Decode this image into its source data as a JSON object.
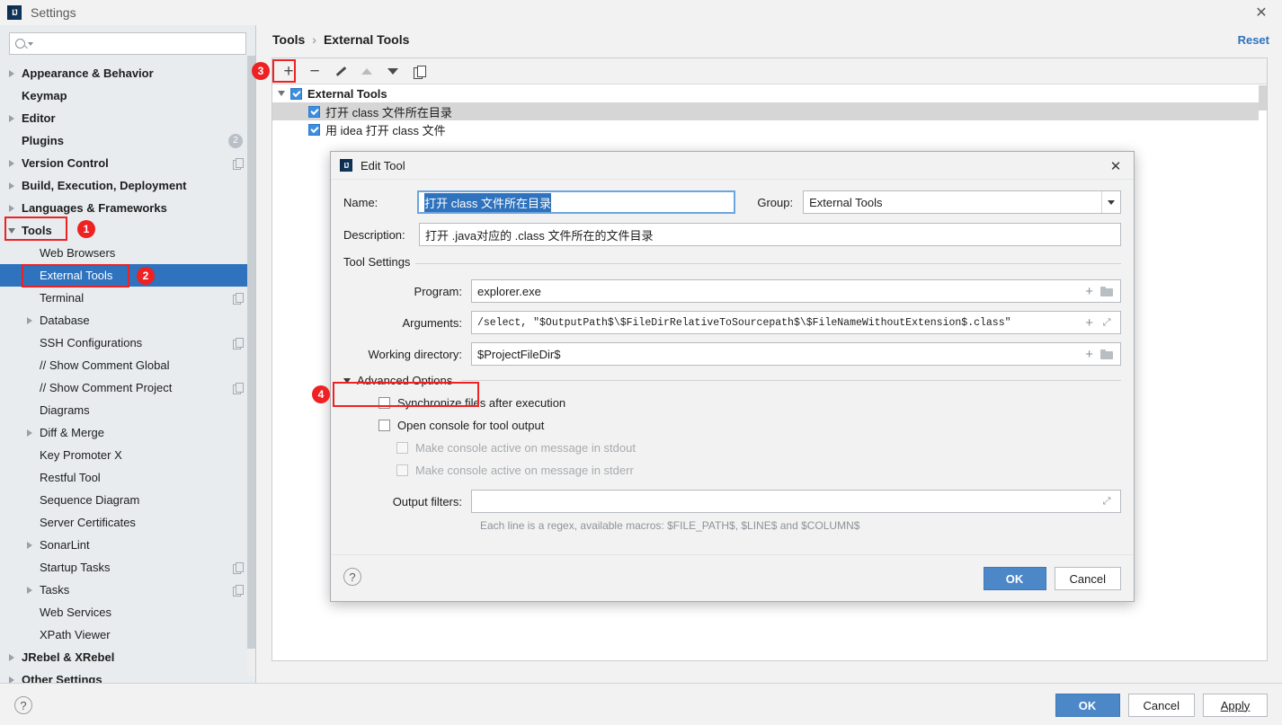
{
  "window": {
    "title": "Settings",
    "logo_text": "IJ",
    "close_icon": "✕"
  },
  "search": {
    "value": "",
    "placeholder": ""
  },
  "sidebar": {
    "items": [
      {
        "label": "Appearance & Behavior",
        "level": 0,
        "twisty": "right",
        "bold": true
      },
      {
        "label": "Keymap",
        "level": 0,
        "twisty": "none",
        "bold": true
      },
      {
        "label": "Editor",
        "level": 0,
        "twisty": "right",
        "bold": true
      },
      {
        "label": "Plugins",
        "level": 0,
        "twisty": "none",
        "bold": true,
        "badge": "2"
      },
      {
        "label": "Version Control",
        "level": 0,
        "twisty": "right",
        "bold": true,
        "copy": true
      },
      {
        "label": "Build, Execution, Deployment",
        "level": 0,
        "twisty": "right",
        "bold": true
      },
      {
        "label": "Languages & Frameworks",
        "level": 0,
        "twisty": "right",
        "bold": true
      },
      {
        "label": "Tools",
        "level": 0,
        "twisty": "down",
        "bold": true
      },
      {
        "label": "Web Browsers",
        "level": 1,
        "twisty": "none"
      },
      {
        "label": "External Tools",
        "level": 1,
        "twisty": "none",
        "selected": true
      },
      {
        "label": "Terminal",
        "level": 1,
        "twisty": "none",
        "copy": true
      },
      {
        "label": "Database",
        "level": 1,
        "twisty": "right"
      },
      {
        "label": "SSH Configurations",
        "level": 1,
        "twisty": "none",
        "copy": true
      },
      {
        "label": "// Show Comment Global",
        "level": 1,
        "twisty": "none"
      },
      {
        "label": "// Show Comment Project",
        "level": 1,
        "twisty": "none",
        "copy": true
      },
      {
        "label": "Diagrams",
        "level": 1,
        "twisty": "none"
      },
      {
        "label": "Diff & Merge",
        "level": 1,
        "twisty": "right"
      },
      {
        "label": "Key Promoter X",
        "level": 1,
        "twisty": "none"
      },
      {
        "label": "Restful Tool",
        "level": 1,
        "twisty": "none"
      },
      {
        "label": "Sequence Diagram",
        "level": 1,
        "twisty": "none"
      },
      {
        "label": "Server Certificates",
        "level": 1,
        "twisty": "none"
      },
      {
        "label": "SonarLint",
        "level": 1,
        "twisty": "right"
      },
      {
        "label": "Startup Tasks",
        "level": 1,
        "twisty": "none",
        "copy": true
      },
      {
        "label": "Tasks",
        "level": 1,
        "twisty": "right",
        "copy": true
      },
      {
        "label": "Web Services",
        "level": 1,
        "twisty": "none"
      },
      {
        "label": "XPath Viewer",
        "level": 1,
        "twisty": "none"
      },
      {
        "label": "JRebel & XRebel",
        "level": 0,
        "twisty": "right",
        "bold": true
      },
      {
        "label": "Other Settings",
        "level": 0,
        "twisty": "right",
        "bold": true
      }
    ]
  },
  "content": {
    "breadcrumb_root": "Tools",
    "breadcrumb_sep": "›",
    "breadcrumb_leaf": "External Tools",
    "reset_label": "Reset",
    "toolbar": {
      "add": "+",
      "remove": "−",
      "edit_icon": "pencil-icon",
      "move_up_icon": "arrow-up-icon",
      "move_down_icon": "arrow-down-icon",
      "copy_icon": "copy-icon"
    },
    "tree": [
      {
        "label": "External Tools",
        "level": 0,
        "checked": true,
        "bold": true,
        "twisty": "down"
      },
      {
        "label": "打开 class 文件所在目录",
        "level": 1,
        "checked": true,
        "highlighted": true
      },
      {
        "label": "用 idea 打开 class 文件",
        "level": 1,
        "checked": true
      }
    ]
  },
  "bottom_bar": {
    "help_icon": "?",
    "ok_label": "OK",
    "cancel_label": "Cancel",
    "apply_label": "Apply"
  },
  "edit_tool_dialog": {
    "title": "Edit Tool",
    "logo_text": "IJ",
    "close_icon": "✕",
    "name_label": "Name:",
    "name_value": "打开 class 文件所在目录",
    "group_label": "Group:",
    "group_value": "External Tools",
    "description_label": "Description:",
    "description_value": "打开 .java对应的 .class 文件所在的文件目录",
    "tool_settings_legend": "Tool Settings",
    "program_label": "Program:",
    "program_value": "explorer.exe",
    "arguments_label": "Arguments:",
    "arguments_value": "/select, \"$OutputPath$\\$FileDirRelativeToSourcepath$\\$FileNameWithoutExtension$.class\"",
    "working_directory_label": "Working directory:",
    "working_directory_value": "$ProjectFileDir$",
    "advanced_options_label": "Advanced Options",
    "checkboxes": [
      {
        "label": "Synchronize files after execution",
        "checked": false,
        "disabled": false,
        "indent": 0
      },
      {
        "label": "Open console for tool output",
        "checked": false,
        "disabled": false,
        "indent": 0
      },
      {
        "label": "Make console active on message in stdout",
        "checked": false,
        "disabled": true,
        "indent": 1
      },
      {
        "label": "Make console active on message in stderr",
        "checked": false,
        "disabled": true,
        "indent": 1
      }
    ],
    "output_filters_label": "Output filters:",
    "output_filters_value": "",
    "output_filters_hint": "Each line is a regex, available macros: $FILE_PATH$, $LINE$ and $COLUMN$",
    "help_icon": "?",
    "ok_label": "OK",
    "cancel_label": "Cancel"
  },
  "annotations": [
    {
      "number": "1",
      "target": "tools-sidebar-item"
    },
    {
      "number": "2",
      "target": "external-tools-sidebar-item"
    },
    {
      "number": "3",
      "target": "add-tool-button"
    },
    {
      "number": "4",
      "target": "advanced-options-header"
    }
  ],
  "colors": {
    "accent_blue": "#2f72bd",
    "annotation_red": "#ee2222",
    "primary_button": "#4c87c7",
    "sidebar_bg": "#e8ecef"
  }
}
